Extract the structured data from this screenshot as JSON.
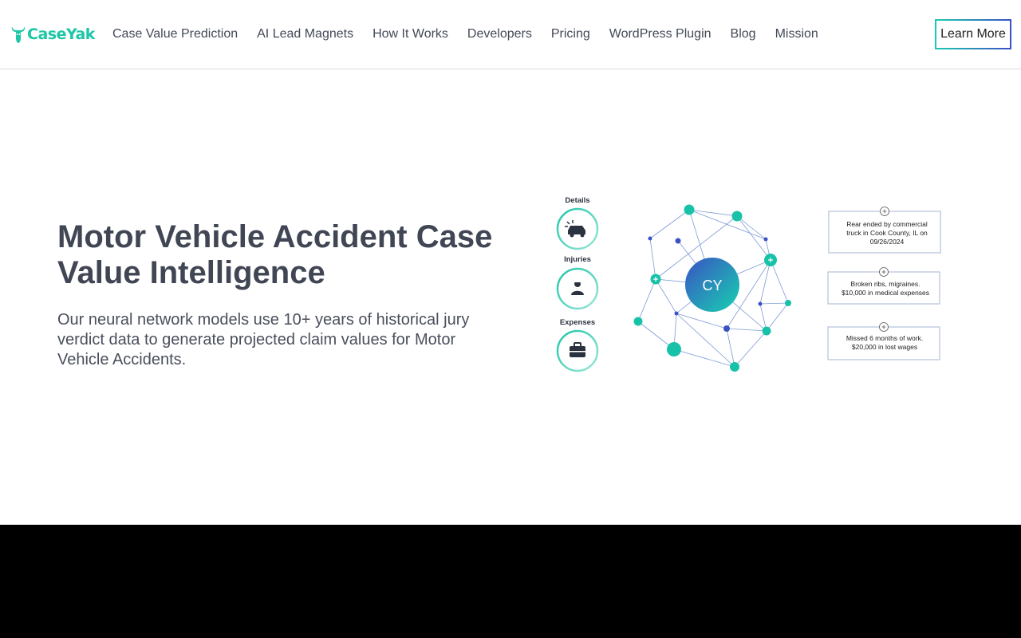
{
  "header": {
    "logo_text": "CaseYak",
    "nav": [
      "Case Value Prediction",
      "AI Lead Magnets",
      "How It Works",
      "Developers",
      "Pricing",
      "WordPress Plugin",
      "Blog",
      "Mission"
    ],
    "cta_label": "Learn More"
  },
  "hero": {
    "title": "Motor Vehicle Accident Case Value Intelligence",
    "subtitle": "Our neural network models use 10+ years of historical jury verdict data to generate projected claim values for Motor Vehicle Accidents."
  },
  "graphic": {
    "categories": [
      {
        "label": "Details",
        "icon": "car-crash-icon"
      },
      {
        "label": "Injuries",
        "icon": "injured-person-icon"
      },
      {
        "label": "Expenses",
        "icon": "briefcase-icon"
      }
    ],
    "center_label": "CY",
    "cards": [
      {
        "lines": [
          "Rear ended by commercial",
          "truck in Cook County, IL on",
          "09/26/2024"
        ]
      },
      {
        "lines": [
          "Broken ribs, migraines.",
          "$10,000 in medical expenses"
        ]
      },
      {
        "lines": [
          "Missed 6 months of work.",
          "$20,000 in lost wages"
        ]
      }
    ]
  },
  "colors": {
    "brand": "#1cc6a6",
    "accent_blue": "#3a52c4",
    "text": "#414654",
    "footer": "#000000"
  }
}
